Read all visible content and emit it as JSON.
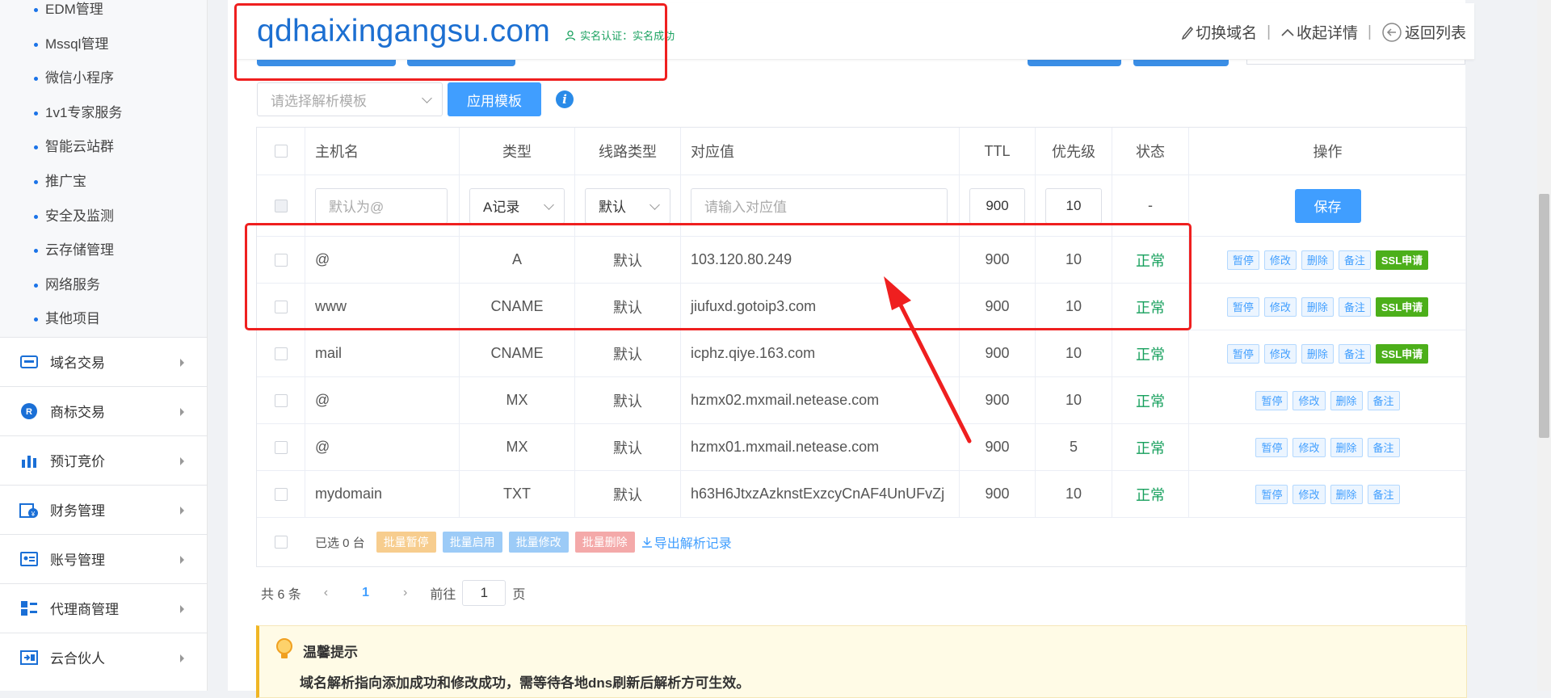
{
  "sidebar": {
    "sub_items": [
      "EDM管理",
      "Mssql管理",
      "微信小程序",
      "1v1专家服务",
      "智能云站群",
      "推广宝",
      "安全及监测",
      "云存储管理",
      "网络服务",
      "其他项目"
    ],
    "main_items": [
      {
        "label": "域名交易",
        "icon": "domain-trade-icon"
      },
      {
        "label": "商标交易",
        "icon": "trademark-icon"
      },
      {
        "label": "预订竞价",
        "icon": "bid-chart-icon"
      },
      {
        "label": "财务管理",
        "icon": "finance-icon"
      },
      {
        "label": "账号管理",
        "icon": "account-icon"
      },
      {
        "label": "代理商管理",
        "icon": "agent-icon"
      },
      {
        "label": "云合伙人",
        "icon": "partner-icon"
      }
    ]
  },
  "header": {
    "domain": "qdhaixingangsu.com",
    "verify_text": "实名认证：实名成功",
    "switch_domain": "切换域名",
    "collapse_details": "收起详情",
    "back_to_list": "返回列表",
    "separator": "|"
  },
  "template": {
    "select_placeholder": "请选择解析模板",
    "apply_button": "应用模板"
  },
  "table": {
    "headers": {
      "host": "主机名",
      "type": "类型",
      "line": "线路类型",
      "value": "对应值",
      "ttl": "TTL",
      "priority": "优先级",
      "status": "状态",
      "ops": "操作"
    },
    "edit_row": {
      "host_placeholder": "默认为@",
      "type_value": "A记录",
      "line_value": "默认",
      "value_placeholder": "请输入对应值",
      "ttl": "900",
      "priority": "10",
      "status": "-",
      "save_button": "保存"
    },
    "rows": [
      {
        "host": "@",
        "type": "A",
        "line": "默认",
        "value": "103.120.80.249",
        "ttl": "900",
        "priority": "10",
        "status": "正常"
      },
      {
        "host": "www",
        "type": "CNAME",
        "line": "默认",
        "value": "jiufuxd.gotoip3.com",
        "ttl": "900",
        "priority": "10",
        "status": "正常"
      },
      {
        "host": "mail",
        "type": "CNAME",
        "line": "默认",
        "value": "icphz.qiye.163.com",
        "ttl": "900",
        "priority": "10",
        "status": "正常"
      },
      {
        "host": "@",
        "type": "MX",
        "line": "默认",
        "value": "hzmx02.mxmail.netease.com",
        "ttl": "900",
        "priority": "10",
        "status": "正常"
      },
      {
        "host": "@",
        "type": "MX",
        "line": "默认",
        "value": "hzmx01.mxmail.netease.com",
        "ttl": "900",
        "priority": "5",
        "status": "正常"
      },
      {
        "host": "mydomain",
        "type": "TXT",
        "line": "默认",
        "value": "h63H6JtxzAzknstExzcyCnAF4UnUFvZj",
        "ttl": "900",
        "priority": "10",
        "status": "正常"
      }
    ],
    "op_labels": {
      "pause": "暂停",
      "edit": "修改",
      "delete": "删除",
      "note": "备注",
      "ssl": "SSL申请"
    },
    "footer": {
      "selected": "已选 0 台",
      "batch_pause": "批量暂停",
      "batch_enable": "批量启用",
      "batch_edit": "批量修改",
      "batch_delete": "批量删除",
      "export": "导出解析记录"
    }
  },
  "pager": {
    "total": "共 6 条",
    "current": "1",
    "goto_label": "前往",
    "goto_value": "1",
    "page_suffix": "页"
  },
  "tip": {
    "title": "温馨提示",
    "text": "域名解析指向添加成功和修改成功，需等待各地dns刷新后解析方可生效。"
  },
  "colors": {
    "primary": "#409eff",
    "domain": "#1c6fd1",
    "ok": "#17a05d",
    "ssl": "#4caf1a",
    "annotation": "#ef1f1f"
  }
}
